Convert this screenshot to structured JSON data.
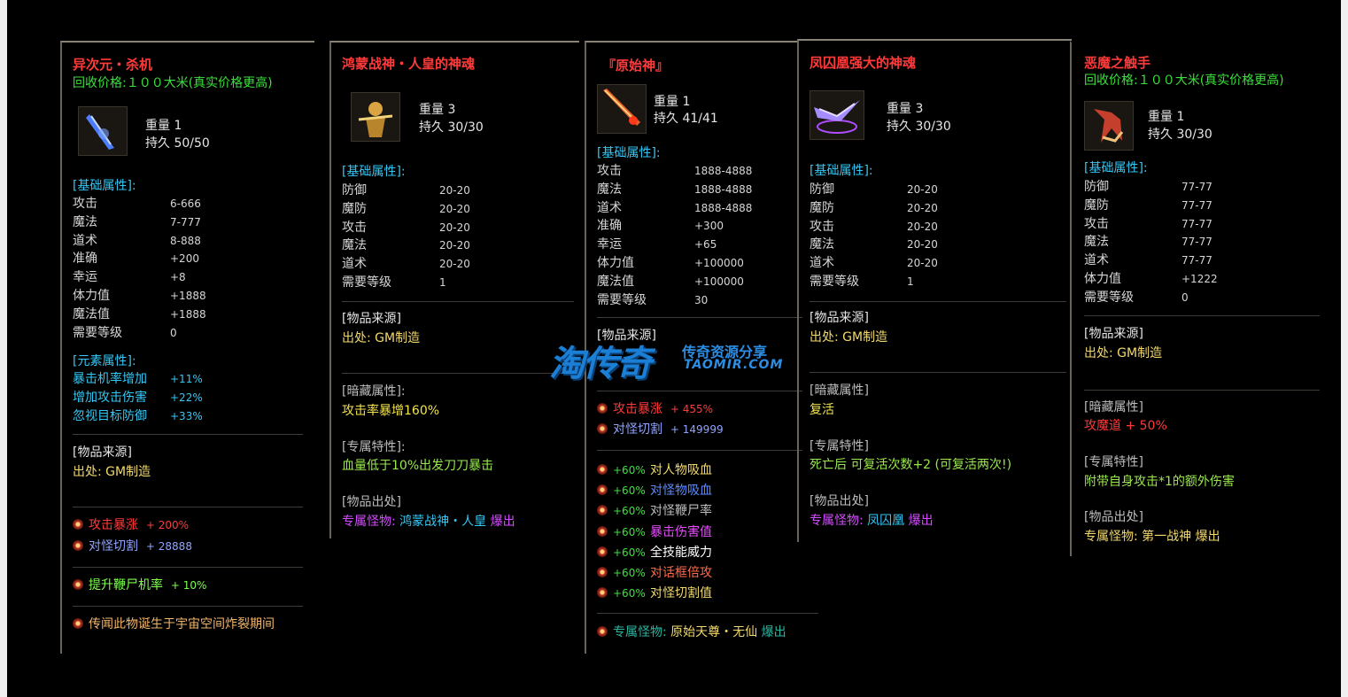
{
  "panels": [
    {
      "title": "异次元・杀机",
      "price_label": "回收价格:",
      "price_value": "１００大米(真实价格更高)",
      "weight": "重量  1",
      "durability": "持久  50/50",
      "base_header": "[基础属性]:",
      "base_stats": [
        {
          "k": "攻击",
          "v": "6-666"
        },
        {
          "k": "魔法",
          "v": "7-777"
        },
        {
          "k": "道术",
          "v": "8-888"
        },
        {
          "k": "准确",
          "v": "+200"
        },
        {
          "k": "幸运",
          "v": "+8"
        },
        {
          "k": "体力值",
          "v": "+1888"
        },
        {
          "k": "魔法值",
          "v": "+1888"
        },
        {
          "k": "需要等级",
          "v": "0"
        }
      ],
      "element_header": "[元素属性]:",
      "element_stats": [
        {
          "k": "暴击机率增加",
          "v": "+11%"
        },
        {
          "k": "增加攻击伤害",
          "v": "+22%"
        },
        {
          "k": "忽视目标防御",
          "v": "+33%"
        }
      ],
      "source_header": "[物品来源]",
      "source_value": "出处: GM制造",
      "specials": [
        {
          "k": "攻击暴涨",
          "v": "+ 200%"
        },
        {
          "k": "对怪切割",
          "v": "+ 28888"
        }
      ],
      "extra1": {
        "k": "提升鞭尸机率",
        "v": "+ 10%"
      },
      "legend": "传闻此物诞生于宇宙空间炸裂期间"
    },
    {
      "title": "鸿蒙战神・人皇的神魂",
      "weight": "重量  3",
      "durability": "持久  30/30",
      "base_header": "[基础属性]:",
      "base_stats": [
        {
          "k": "防御",
          "v": "20-20"
        },
        {
          "k": "魔防",
          "v": "20-20"
        },
        {
          "k": "攻击",
          "v": "20-20"
        },
        {
          "k": "魔法",
          "v": "20-20"
        },
        {
          "k": "道术",
          "v": "20-20"
        },
        {
          "k": "需要等级",
          "v": "1"
        }
      ],
      "source_header": "[物品来源]",
      "source_value": "出处: GM制造",
      "hidden_header": "[暗藏属性]:",
      "hidden_value": "攻击率暴增160%",
      "trait_header": "[专属特性]:",
      "trait_value": "血量低于10%出发刀刀暴击",
      "drop_header": "[物品出处]",
      "drop_prefix": "专属怪物:",
      "drop_monster": "鸿蒙战神・人皇",
      "drop_suffix": "爆出"
    },
    {
      "title": "『原始神』",
      "weight": "重量  1",
      "durability": "持久  41/41",
      "base_header": "[基础属性]:",
      "base_stats": [
        {
          "k": "攻击",
          "v": "1888-4888"
        },
        {
          "k": "魔法",
          "v": "1888-4888"
        },
        {
          "k": "道术",
          "v": "1888-4888"
        },
        {
          "k": "准确",
          "v": "+300"
        },
        {
          "k": "幸运",
          "v": "+65"
        },
        {
          "k": "体力值",
          "v": "+100000"
        },
        {
          "k": "魔法值",
          "v": "+100000"
        },
        {
          "k": "需要等级",
          "v": "30"
        }
      ],
      "source_header": "[物品来源]",
      "specials": [
        {
          "k": "攻击暴涨",
          "v": "+ 455%"
        },
        {
          "k": "对怪切割",
          "v": "+ 149999"
        }
      ],
      "bonuses": [
        {
          "pct": "+60%",
          "label": "对人物吸血",
          "color": "#f2d96b"
        },
        {
          "pct": "+60%",
          "label": "对怪物吸血",
          "color": "#5a8cff"
        },
        {
          "pct": "+60%",
          "label": "对怪鞭尸率",
          "color": "#bcbcbc"
        },
        {
          "pct": "+60%",
          "label": "暴击伤害值",
          "color": "#e84cff"
        },
        {
          "pct": "+60%",
          "label": "全技能威力",
          "color": "#ffffff"
        },
        {
          "pct": "+60%",
          "label": "对话框倍攻",
          "color": "#ff6b4a"
        },
        {
          "pct": "+60%",
          "label": "对怪切割值",
          "color": "#f2d96b"
        }
      ],
      "drop_prefix": "专属怪物:",
      "drop_monster": "原始天尊・无仙",
      "drop_suffix": "爆出"
    },
    {
      "title": "凤囚凰强大的神魂",
      "weight": "重量  3",
      "durability": "持久  30/30",
      "base_header": "[基础属性]:",
      "base_stats": [
        {
          "k": "防御",
          "v": "20-20"
        },
        {
          "k": "魔防",
          "v": "20-20"
        },
        {
          "k": "攻击",
          "v": "20-20"
        },
        {
          "k": "魔法",
          "v": "20-20"
        },
        {
          "k": "道术",
          "v": "20-20"
        },
        {
          "k": "需要等级",
          "v": "1"
        }
      ],
      "source_header": "[物品来源]",
      "source_value": "出处: GM制造",
      "hidden_header": "[暗藏属性]",
      "hidden_value": "复活",
      "trait_header": "[专属特性]",
      "trait_value": "死亡后 可复活次数+2 (可复活两次!)",
      "drop_header": "[物品出处]",
      "drop_prefix": "专属怪物:",
      "drop_monster": "凤囚凰",
      "drop_suffix": "爆出"
    },
    {
      "title": "恶魔之触手",
      "price_label": "回收价格:",
      "price_value": "１００大米(真实价格更高)",
      "weight": "重量  1",
      "durability": "持久  30/30",
      "base_header": "[基础属性]:",
      "base_stats": [
        {
          "k": "防御",
          "v": "77-77"
        },
        {
          "k": "魔防",
          "v": "77-77"
        },
        {
          "k": "攻击",
          "v": "77-77"
        },
        {
          "k": "魔法",
          "v": "77-77"
        },
        {
          "k": "道术",
          "v": "77-77"
        },
        {
          "k": "体力值",
          "v": "+1222"
        },
        {
          "k": "需要等级",
          "v": "0"
        }
      ],
      "source_header": "[物品来源]",
      "source_value": "出处: GM制造",
      "hidden_header": "[暗藏属性]",
      "hidden_value": "攻魔道 + 50%",
      "trait_header": "[专属特性]",
      "trait_value": "附带自身攻击*1的额外伤害",
      "drop_header": "[物品出处]",
      "drop_prefix": "专属怪物:",
      "drop_monster": "第一战神",
      "drop_suffix": "爆出"
    }
  ],
  "watermark": {
    "big": "淘传奇",
    "small": "传奇资源分享",
    "url": "TAOMIR.COM"
  }
}
